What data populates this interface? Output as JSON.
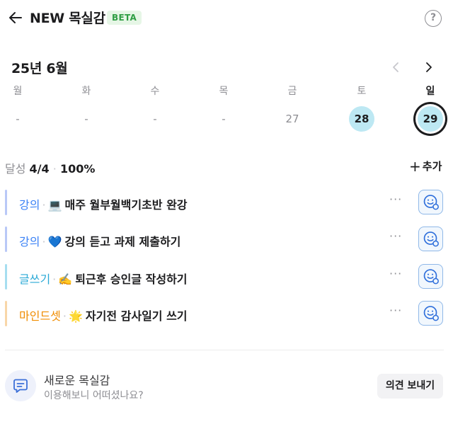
{
  "header": {
    "title": "NEW 목실감",
    "badge": "BETA",
    "help_label": "?"
  },
  "calendar": {
    "month_label": "25년 6월",
    "days": [
      {
        "weekday": "월",
        "date": "-",
        "state": "none"
      },
      {
        "weekday": "화",
        "date": "-",
        "state": "none"
      },
      {
        "weekday": "수",
        "date": "-",
        "state": "none"
      },
      {
        "weekday": "목",
        "date": "-",
        "state": "none"
      },
      {
        "weekday": "금",
        "date": "27",
        "state": "none"
      },
      {
        "weekday": "토",
        "date": "28",
        "state": "done"
      },
      {
        "weekday": "일",
        "date": "29",
        "state": "today"
      }
    ]
  },
  "summary": {
    "label": "달성",
    "count": "4/4",
    "percent": "100%",
    "add_label": "추가"
  },
  "goals": [
    {
      "category": "강의",
      "category_color": "#3b82f6",
      "emoji": "💻",
      "text": "매주 월부월백기초반 완강",
      "more": "···"
    },
    {
      "category": "강의",
      "category_color": "#3b82f6",
      "emoji": "💙",
      "text": "강의 듣고 과제 제출하기",
      "more": "···"
    },
    {
      "category": "글쓰기",
      "category_color": "#29a9d6",
      "emoji": "✍️",
      "text": "퇴근후 승인글 작성하기",
      "more": "···"
    },
    {
      "category": "마인드셋",
      "category_color": "#f08c00",
      "emoji": "🌟",
      "text": "자기전 감사일기 쓰기",
      "more": "···"
    }
  ],
  "goal_bar_colors": [
    "#b9c8f7",
    "#b9c8f7",
    "#a6def0",
    "#f8d6a8"
  ],
  "feedback": {
    "title": "새로운 목실감",
    "subtitle": "이용해보니 어떠셨나요?",
    "button_label": "의견 보내기"
  }
}
